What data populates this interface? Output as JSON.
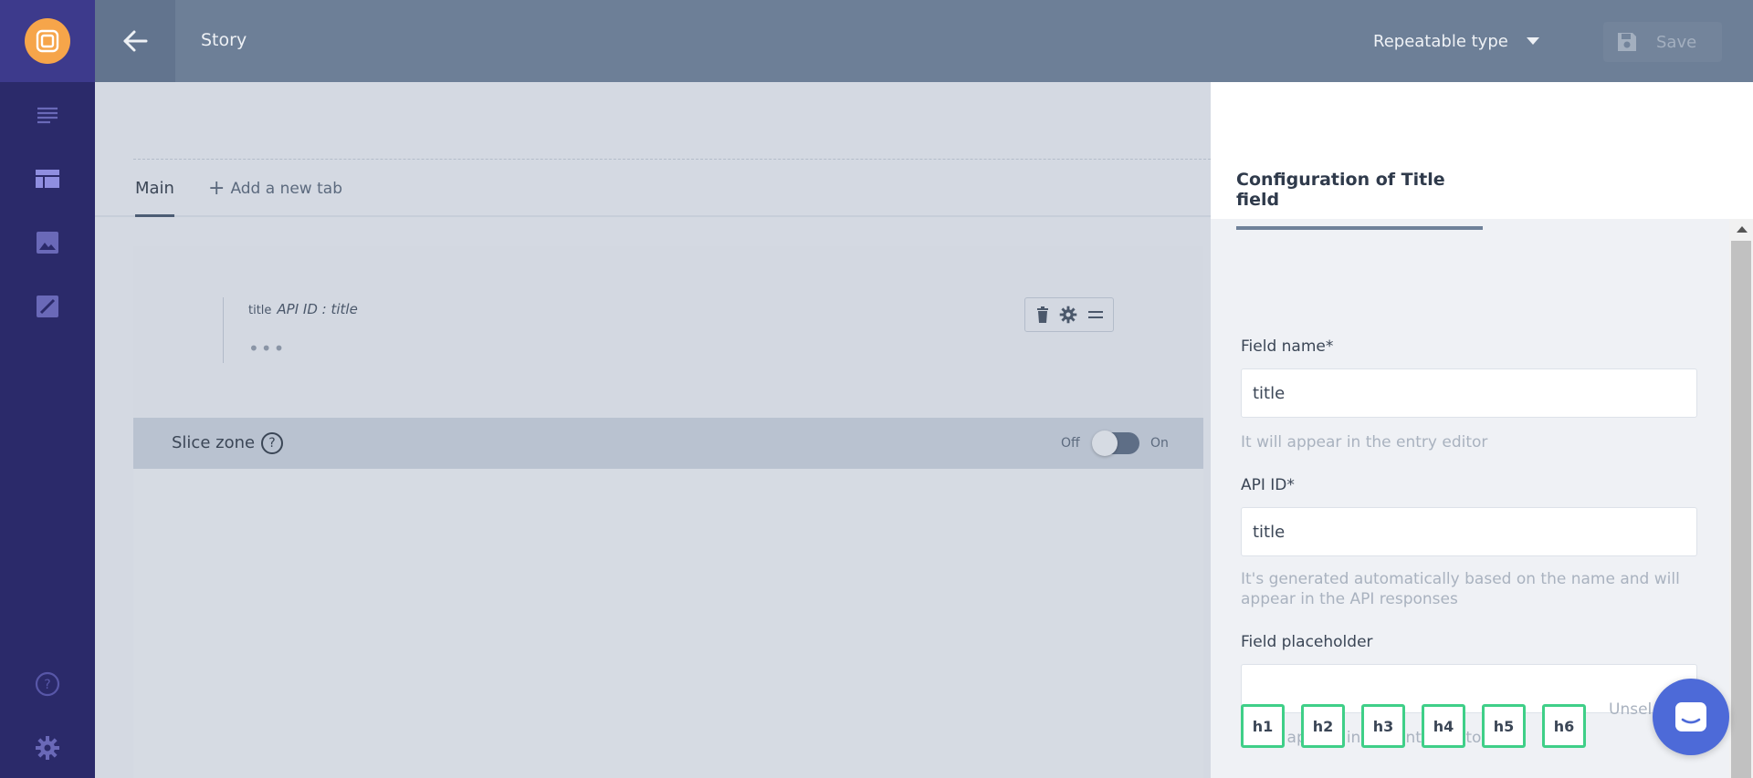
{
  "header": {
    "title": "Story",
    "type_select": "Repeatable type",
    "save_label": "Save"
  },
  "tabs": {
    "main_label": "Main",
    "add_label": "Add a new tab"
  },
  "field": {
    "label": "title",
    "api_id_text": "API ID : title",
    "dots": "•••"
  },
  "slice_zone": {
    "label": "Slice zone",
    "help": "?",
    "toggle_off": "Off",
    "toggle_on": "On"
  },
  "panel": {
    "title": "Configuration of Title field",
    "field_name_label": "Field name*",
    "field_name_value": "title",
    "field_name_hint": "It will appear in the entry editor",
    "api_id_label": "API ID*",
    "api_id_value": "title",
    "api_id_hint": "It's generated automatically based on the name and will appear in the API responses",
    "placeholder_label": "Field placeholder",
    "placeholder_value": "",
    "placeholder_hint": "It will appear in the entry editor",
    "headings": [
      "h1",
      "h2",
      "h3",
      "h4",
      "h5",
      "h6"
    ],
    "unselect_label": "Unsel"
  },
  "colors": {
    "rail": "#2b2a6a",
    "topbar": "#6d7f97",
    "logo": "#f6a54a",
    "heading_border": "#3fcf88",
    "chat": "#4d6ad8"
  },
  "icons": [
    "logo-icon",
    "list-icon",
    "table-icon",
    "image-icon",
    "edit-image-icon",
    "help-icon",
    "gear-icon",
    "arrow-left-icon",
    "caret-down-icon",
    "save-icon",
    "trash-icon",
    "drag-handle-icon",
    "chat-icon"
  ]
}
